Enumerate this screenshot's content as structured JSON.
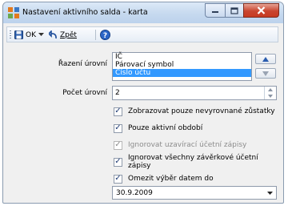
{
  "window": {
    "title": "Nastavení aktivního salda - karta",
    "app_icon": "grid-icon",
    "controls": [
      "minimize-icon",
      "maximize-icon",
      "close-icon"
    ]
  },
  "toolbar": {
    "ok_label": "OK",
    "back_label": "Zpět",
    "icons": [
      "save-icon",
      "dropdown-arrow-icon",
      "undo-icon",
      "help-icon"
    ]
  },
  "form": {
    "sort_levels": {
      "label": "Řazení úrovní",
      "items": [
        "IČ",
        "Párovací symbol",
        "Číslo účtu"
      ],
      "selected_index": 2,
      "up_icon": "arrow-up-icon",
      "down_icon": "arrow-down-icon"
    },
    "level_count": {
      "label": "Počet úrovní",
      "value": "2"
    },
    "checkboxes": [
      {
        "label": "Zobrazovat pouze nevyrovnané zůstatky",
        "checked": true,
        "enabled": true
      },
      {
        "label": "Pouze aktivní období",
        "checked": true,
        "enabled": true
      },
      {
        "label": "Ignorovat uzavírací účetní zápisy",
        "checked": true,
        "enabled": false
      },
      {
        "label": "Ignorovat všechny závěrkové účetní zápisy",
        "checked": true,
        "enabled": true
      },
      {
        "label": "Omezit výběr datem do",
        "checked": true,
        "enabled": true
      }
    ],
    "date_to": {
      "value": "30.9.2009"
    }
  },
  "colors": {
    "selection": "#3399ff",
    "close_button": "#c73a21",
    "title_bar": "#c6d9ef"
  }
}
